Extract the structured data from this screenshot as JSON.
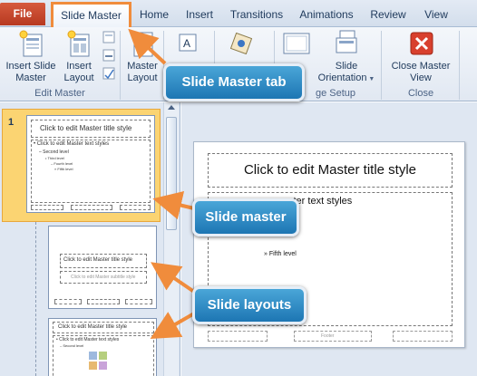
{
  "tabs": {
    "file": "File",
    "slide_master": "Slide Master",
    "home": "Home",
    "insert": "Insert",
    "transitions": "Transitions",
    "animations": "Animations",
    "review": "Review",
    "view": "View"
  },
  "ribbon": {
    "insert_slide_master": "Insert Slide Master",
    "insert_layout": "Insert Layout",
    "master_layout": "Master Layout",
    "slide_orientation": "Slide Orientation",
    "close_master_view": "Close Master View",
    "group_edit_master": "Edit Master",
    "group_page_setup": "ge Setup",
    "group_close": "Close"
  },
  "thumbnails": {
    "slide_number": "1",
    "master_title": "Click to edit Master title style",
    "master_text": "• Click to edit Master text styles",
    "second_level": "– Second level",
    "third_level": "• Third level",
    "fourth_level": "– Fourth level",
    "fifth_level": "» Fifth level",
    "layout_title": "Click to edit Master title style",
    "layout_subtitle": "Click to edit Master subtitle style",
    "layout3_title": "Click to edit Master title style",
    "layout3_text": "• Click to edit Master text styles",
    "layout3_second": "– Second level"
  },
  "main_slide": {
    "title": "Click to edit Master title style",
    "text_partial": "ster text styles",
    "fifth_level": "» Fifth level",
    "footer": "Footer"
  },
  "callouts": {
    "slide_master_tab": "Slide Master tab",
    "slide_master": "Slide master",
    "slide_layouts": "Slide layouts"
  },
  "colors": {
    "accent_orange": "#f08c3c",
    "callout_blue": "#2a86c4",
    "file_tab": "#c4452b",
    "selected_thumb": "#fbd472"
  }
}
